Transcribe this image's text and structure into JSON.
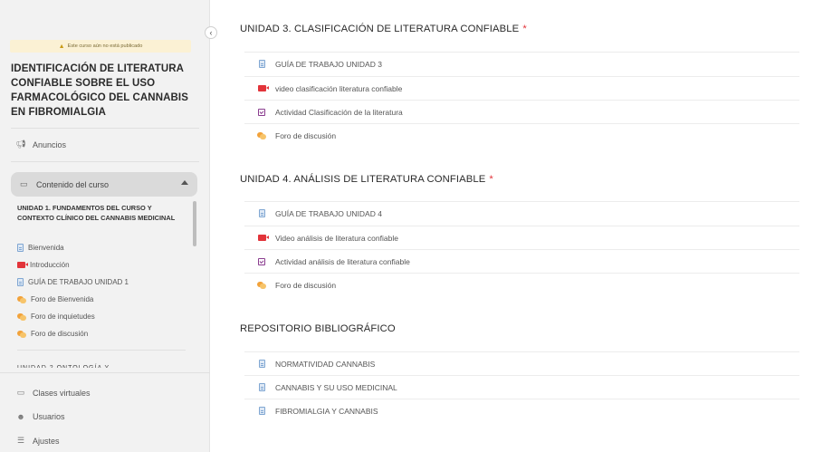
{
  "sidebar": {
    "collapse_glyph": "‹",
    "notice": "Este curso aún no está publicado",
    "course_title": "IDENTIFICACIÓN DE LITERATURA CONFIABLE SOBRE EL USO FARMACOLÓGICO DEL CANNABIS EN FIBROMIALGIA",
    "announcements": "Anuncios",
    "course_content": "Contenido del curso",
    "unit1_title": "UNIDAD 1. FUNDAMENTOS DEL CURSO Y CONTEXTO CLÍNICO DEL CANNABIS MEDICINAL",
    "unit1_items": [
      {
        "label": "Bienvenida",
        "icon": "document-icon"
      },
      {
        "label": "Introducción",
        "icon": "video-icon"
      },
      {
        "label": "GUÍA DE TRABAJO UNIDAD 1",
        "icon": "document-icon"
      },
      {
        "label": "Foro de Bienvenida",
        "icon": "forum-icon"
      },
      {
        "label": "Foro de inquietudes",
        "icon": "forum-icon"
      },
      {
        "label": "Foro de discusión",
        "icon": "forum-icon"
      }
    ],
    "partial_next": "UNIDAD 2 ONTOLOGÍA Y ...",
    "virtual_classes": "Clases virtuales",
    "users": "Usuarios",
    "settings": "Ajustes"
  },
  "main": {
    "unit3": {
      "title": "UNIDAD 3. CLASIFICACIÓN DE LITERATURA CONFIABLE",
      "required_mark": "*",
      "items": [
        {
          "label": "GUÍA DE TRABAJO UNIDAD 3",
          "icon": "document-icon"
        },
        {
          "label": "video clasificación literatura confiable",
          "icon": "video-icon"
        },
        {
          "label": "Actividad Clasificación de la literatura",
          "icon": "activity-icon"
        },
        {
          "label": "Foro de discusión",
          "icon": "forum-icon"
        }
      ]
    },
    "unit4": {
      "title": "UNIDAD 4. ANÁLISIS DE LITERATURA CONFIABLE",
      "required_mark": "*",
      "items": [
        {
          "label": "GUÍA DE TRABAJO UNIDAD 4",
          "icon": "document-icon"
        },
        {
          "label": "Video análisis de literatura confiable",
          "icon": "video-icon"
        },
        {
          "label": "Actividad análisis de literatura confiable",
          "icon": "activity-icon"
        },
        {
          "label": "Foro de discusión",
          "icon": "forum-icon"
        }
      ]
    },
    "repository": {
      "title": "REPOSITORIO BIBLIOGRÁFICO",
      "items": [
        {
          "label": "NORMATIVIDAD CANNABIS",
          "icon": "document-icon"
        },
        {
          "label": "CANNABIS Y SU USO MEDICINAL",
          "icon": "document-icon"
        },
        {
          "label": "FIBROMIALGIA Y CANNABIS",
          "icon": "document-icon"
        }
      ]
    }
  },
  "colors": {
    "video": "#e2343a",
    "activity": "#8a3d8f",
    "forum": "#f2a23a",
    "document": "#7fa6d2",
    "required": "#e2343a"
  }
}
